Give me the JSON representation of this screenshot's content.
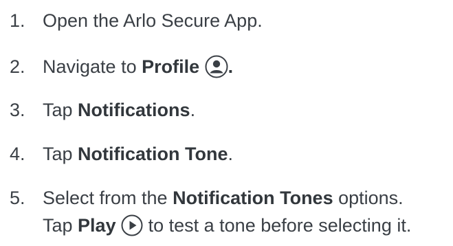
{
  "steps": [
    {
      "number": "1.",
      "text_before": "Open the Arlo Secure App."
    },
    {
      "number": "2.",
      "text_before": "Navigate to ",
      "bold": "Profile",
      "icon": "profile-icon",
      "text_after": "."
    },
    {
      "number": "3.",
      "text_before": "Tap ",
      "bold": "Notifications",
      "text_after": "."
    },
    {
      "number": "4.",
      "text_before": "Tap ",
      "bold": "Notification Tone",
      "text_after": "."
    },
    {
      "number": "5.",
      "text_before": "Select from the ",
      "bold": "Notification Tones",
      "text_after": " options.",
      "line2_before": "Tap ",
      "line2_bold": "Play",
      "line2_icon": "play-icon",
      "line2_after": " to test a tone before selecting it."
    }
  ],
  "colors": {
    "text": "#3a3f45",
    "icon_fill": "#3a3f45"
  }
}
